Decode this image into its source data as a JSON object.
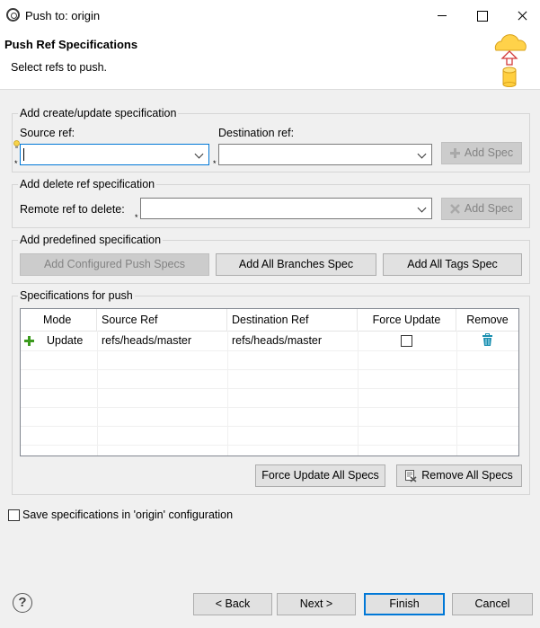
{
  "window": {
    "title": "Push to: origin",
    "icon": "eclipse-icon"
  },
  "header": {
    "title": "Push Ref Specifications",
    "description": "Select refs to push.",
    "icon": "cloud-upload-database-icon"
  },
  "create_group": {
    "legend": "Add create/update specification",
    "source_label": "Source ref:",
    "source_value": "",
    "destination_label": "Destination ref:",
    "destination_value": "",
    "add_button": "Add Spec"
  },
  "delete_group": {
    "legend": "Add delete ref specification",
    "remote_label": "Remote ref to delete:",
    "remote_value": "",
    "add_button": "Add Spec"
  },
  "predefined_group": {
    "legend": "Add predefined specification",
    "configured_button": "Add Configured Push Specs",
    "branches_button": "Add All Branches Spec",
    "tags_button": "Add All Tags Spec"
  },
  "specs_group": {
    "legend": "Specifications for push",
    "columns": [
      "Mode",
      "Source Ref",
      "Destination Ref",
      "Force Update",
      "Remove"
    ],
    "rows": [
      {
        "mode": "Update",
        "source": "refs/heads/master",
        "destination": "refs/heads/master",
        "force": false
      }
    ],
    "force_all_button": "Force Update All Specs",
    "remove_all_button": "Remove All Specs"
  },
  "save_config": {
    "label": "Save specifications in 'origin' configuration",
    "checked": false
  },
  "footer": {
    "back": "< Back",
    "next": "Next >",
    "finish": "Finish",
    "cancel": "Cancel"
  },
  "colors": {
    "accent": "#0078d7",
    "add_icon": "#3c9a1e",
    "remove_icon": "#1a8fb0"
  }
}
